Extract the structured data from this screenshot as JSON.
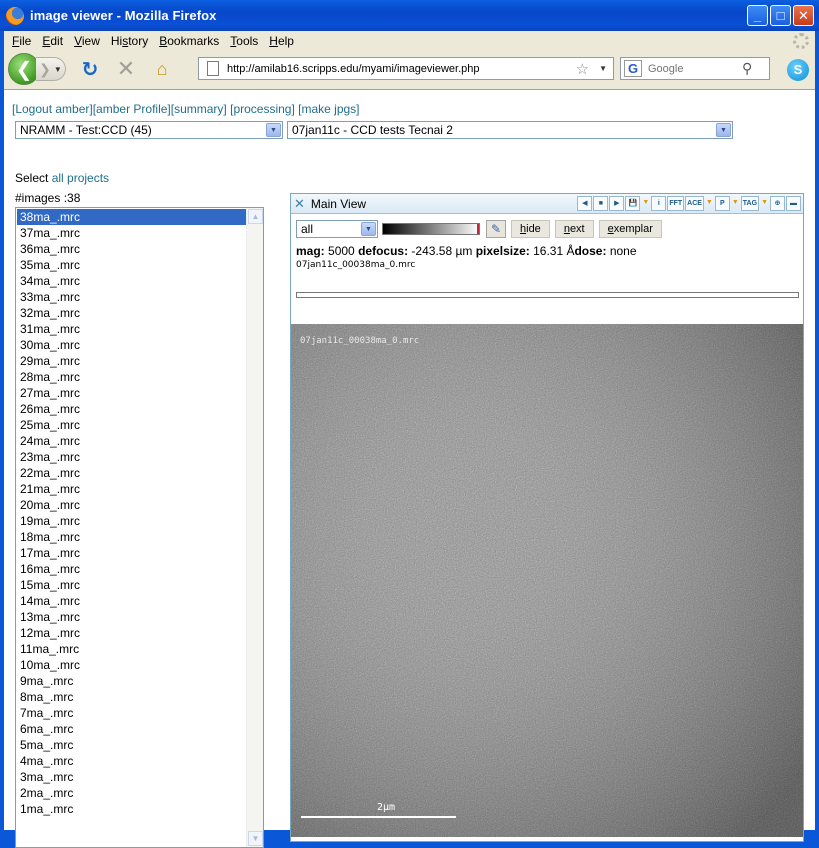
{
  "window": {
    "title": "image viewer - Mozilla Firefox",
    "minimize_icon": "minimize-icon",
    "maximize_icon": "maximize-icon",
    "close_icon": "close-icon"
  },
  "menu": {
    "items": [
      {
        "key": "F",
        "rest": "ile"
      },
      {
        "key": "E",
        "rest": "dit"
      },
      {
        "key": "V",
        "rest": "iew"
      },
      {
        "key": "",
        "pre": "Hi",
        "key2": "s",
        "rest": "tory"
      },
      {
        "key": "B",
        "rest": "ookmarks"
      },
      {
        "key": "T",
        "rest": "ools"
      },
      {
        "key": "H",
        "rest": "elp"
      }
    ]
  },
  "nav": {
    "url": "http://amilab16.scripps.edu/myami/imageviewer.php",
    "search_placeholder": "Google"
  },
  "page": {
    "link_logout": "[Logout amber]",
    "link_profile": "[amber Profile]",
    "link_summary": "[summary]",
    "link_processing": "[processing]",
    "link_jpgs": "[make jpgs]",
    "project_select": "NRAMM - Test:CCD (45)",
    "session_select": "07jan11c - CCD tests Tecnai 2",
    "select_text": "Select",
    "all_projects": "all projects",
    "images_count": "#images :38",
    "images": [
      "38ma_.mrc",
      "37ma_.mrc",
      "36ma_.mrc",
      "35ma_.mrc",
      "34ma_.mrc",
      "33ma_.mrc",
      "32ma_.mrc",
      "31ma_.mrc",
      "30ma_.mrc",
      "29ma_.mrc",
      "28ma_.mrc",
      "27ma_.mrc",
      "26ma_.mrc",
      "25ma_.mrc",
      "24ma_.mrc",
      "23ma_.mrc",
      "22ma_.mrc",
      "21ma_.mrc",
      "20ma_.mrc",
      "19ma_.mrc",
      "18ma_.mrc",
      "17ma_.mrc",
      "16ma_.mrc",
      "15ma_.mrc",
      "14ma_.mrc",
      "13ma_.mrc",
      "12ma_.mrc",
      "11ma_.mrc",
      "10ma_.mrc",
      "9ma_.mrc",
      "8ma_.mrc",
      "7ma_.mrc",
      "6ma_.mrc",
      "5ma_.mrc",
      "4ma_.mrc",
      "3ma_.mrc",
      "2ma_.mrc",
      "1ma_.mrc"
    ],
    "selected_image": "38ma_.mrc"
  },
  "viewer": {
    "title": "Main View",
    "toolbar": [
      "◀",
      "■",
      "▶",
      "💾",
      "i",
      "FFT",
      "ACE",
      "P",
      "TAG",
      "⊕",
      "▬"
    ],
    "preset": "all",
    "hide_label": "ide",
    "hide_key": "h",
    "next_label": "ext",
    "next_key": "n",
    "exemplar_label": "xemplar",
    "exemplar_key": "e",
    "mag_label": "mag:",
    "mag_value": "5000",
    "defocus_label": "defocus:",
    "defocus_value": "-243.58 µm",
    "pixelsize_label": "pixelsize:",
    "pixelsize_value": "16.31 Å",
    "dose_label": "dose:",
    "dose_value": "none",
    "filename": "07jan11c_00038ma_0.mrc",
    "image_label": "07jan11c_00038ma_0.mrc",
    "scale_label": "2µm"
  }
}
